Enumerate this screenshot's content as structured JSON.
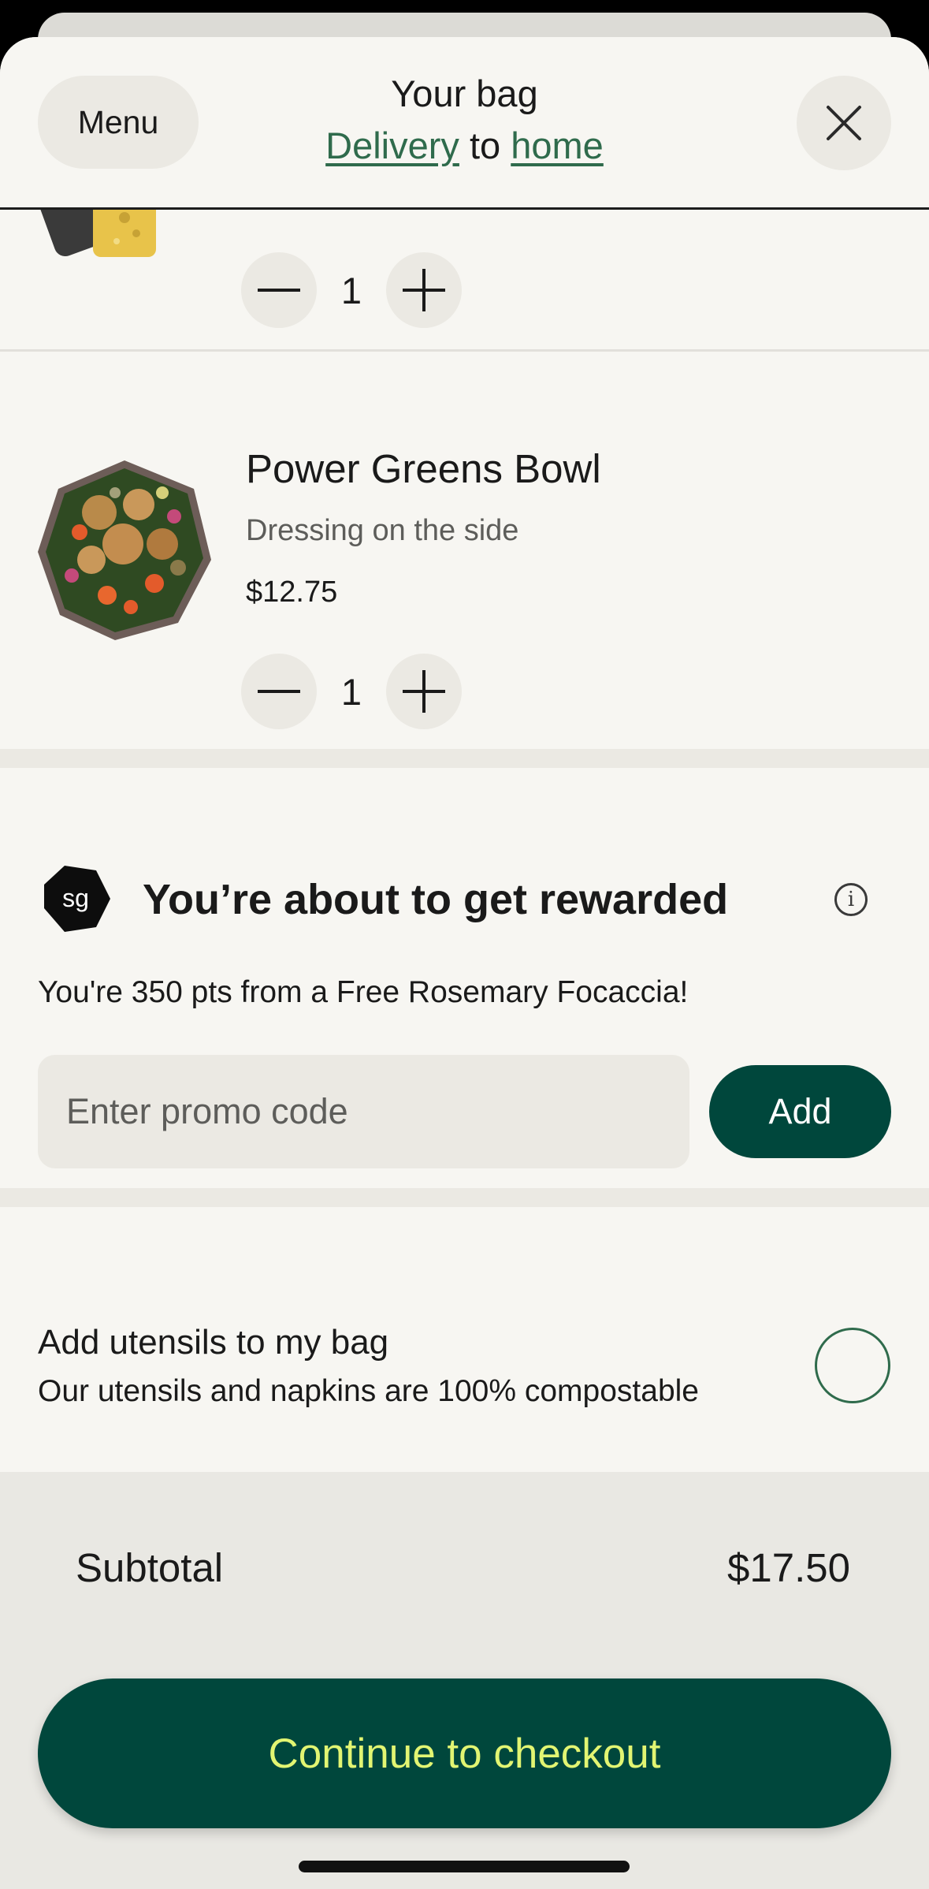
{
  "header": {
    "menu_label": "Menu",
    "title": "Your bag",
    "order_type": "Delivery",
    "connector": "to",
    "location": "home",
    "close_icon": "close-icon"
  },
  "bag_items": [
    {
      "quantity": "1"
    },
    {
      "name": "Power Greens Bowl",
      "modifier": "Dressing on the side",
      "price": "$12.75",
      "quantity": "1"
    }
  ],
  "rewards": {
    "logo_text": "sg",
    "title": "You’re about to get rewarded",
    "info_icon": "i",
    "message": "You're 350 pts from a Free Rosemary Focaccia!",
    "promo_placeholder": "Enter promo code",
    "promo_value": "",
    "add_label": "Add"
  },
  "utensils": {
    "title": "Add utensils to my bag",
    "subtitle": "Our utensils and napkins are 100% compostable",
    "checked": false
  },
  "summary": {
    "subtotal_label": "Subtotal",
    "subtotal_value": "$17.50",
    "checkout_label": "Continue to checkout"
  },
  "colors": {
    "brand_green": "#00473c",
    "link_green": "#2f6b4c",
    "checkout_text": "#e2f572",
    "background": "#f7f6f2"
  }
}
